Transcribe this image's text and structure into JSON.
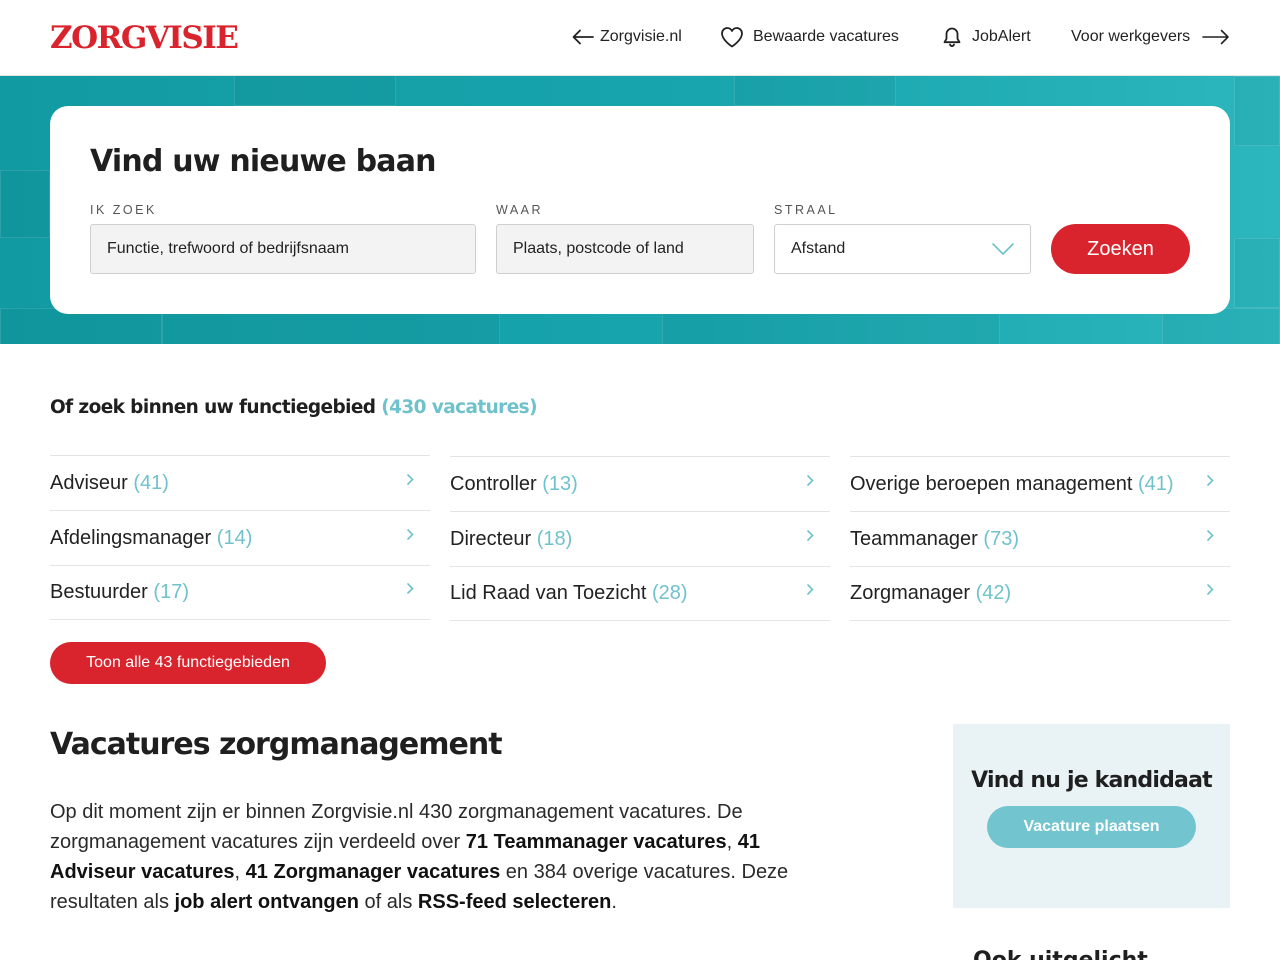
{
  "header": {
    "logo": "ZORGVISIE",
    "nav": {
      "back": "Zorgvisie.nl",
      "saved": "Bewaarde vacatures",
      "alert": "JobAlert",
      "employers": "Voor werkgevers"
    },
    "icons": [
      "arrow-left-icon",
      "heart-icon",
      "bell-icon",
      "arrow-right-icon"
    ]
  },
  "search": {
    "title": "Vind uw nieuwe baan",
    "what_label": "IK ZOEK",
    "what_placeholder": "Functie, trefwoord of bedrijfsnaam",
    "where_label": "WAAR",
    "where_placeholder": "Plaats, postcode of land",
    "radius_label": "STRAAL",
    "radius_value": "Afstand",
    "button": "Zoeken"
  },
  "categories": {
    "heading": "Of zoek binnen uw functiegebied",
    "heading_count": "(430 vacatures)",
    "columns": [
      [
        {
          "name": "Adviseur",
          "count": "(41)"
        },
        {
          "name": "Afdelingsmanager",
          "count": "(14)"
        },
        {
          "name": "Bestuurder",
          "count": "(17)"
        }
      ],
      [
        {
          "name": "Controller",
          "count": "(13)"
        },
        {
          "name": "Directeur",
          "count": "(18)"
        },
        {
          "name": "Lid Raad van Toezicht",
          "count": "(28)"
        }
      ],
      [
        {
          "name": "Overige beroepen management",
          "count": "(41)"
        },
        {
          "name": "Teammanager",
          "count": "(73)"
        },
        {
          "name": "Zorgmanager",
          "count": "(42)"
        }
      ]
    ],
    "show_all": "Toon alle 43 functiegebieden"
  },
  "content": {
    "title": "Vacatures zorgmanagement",
    "p1": "Op dit moment zijn er binnen Zorgvisie.nl 430 zorgmanagement vacatures. De zorgmanagement vacatures zijn verdeeld over ",
    "link1": "71 Teammanager vacatures",
    "sep1": ", ",
    "link2": "41 Adviseur vacatures",
    "sep2": ", ",
    "link3": "41 Zorgmanager vacatures",
    "p2": " en 384 overige vacatures. Deze resultaten als ",
    "link4": "job alert ontvangen",
    "p3": " of als ",
    "link5": "RSS-feed selecteren",
    "p4": "."
  },
  "sidebar": {
    "title": "Vind nu je kandidaat",
    "button": "Vacature plaatsen",
    "next_heading": "Ook uitgelicht"
  },
  "colors": {
    "brand_red": "#d9232d",
    "teal": "#18a5ad",
    "count_teal": "#6fc2cc",
    "sidebar_bg": "#e9f3f5",
    "post_button": "#72c4cf"
  }
}
